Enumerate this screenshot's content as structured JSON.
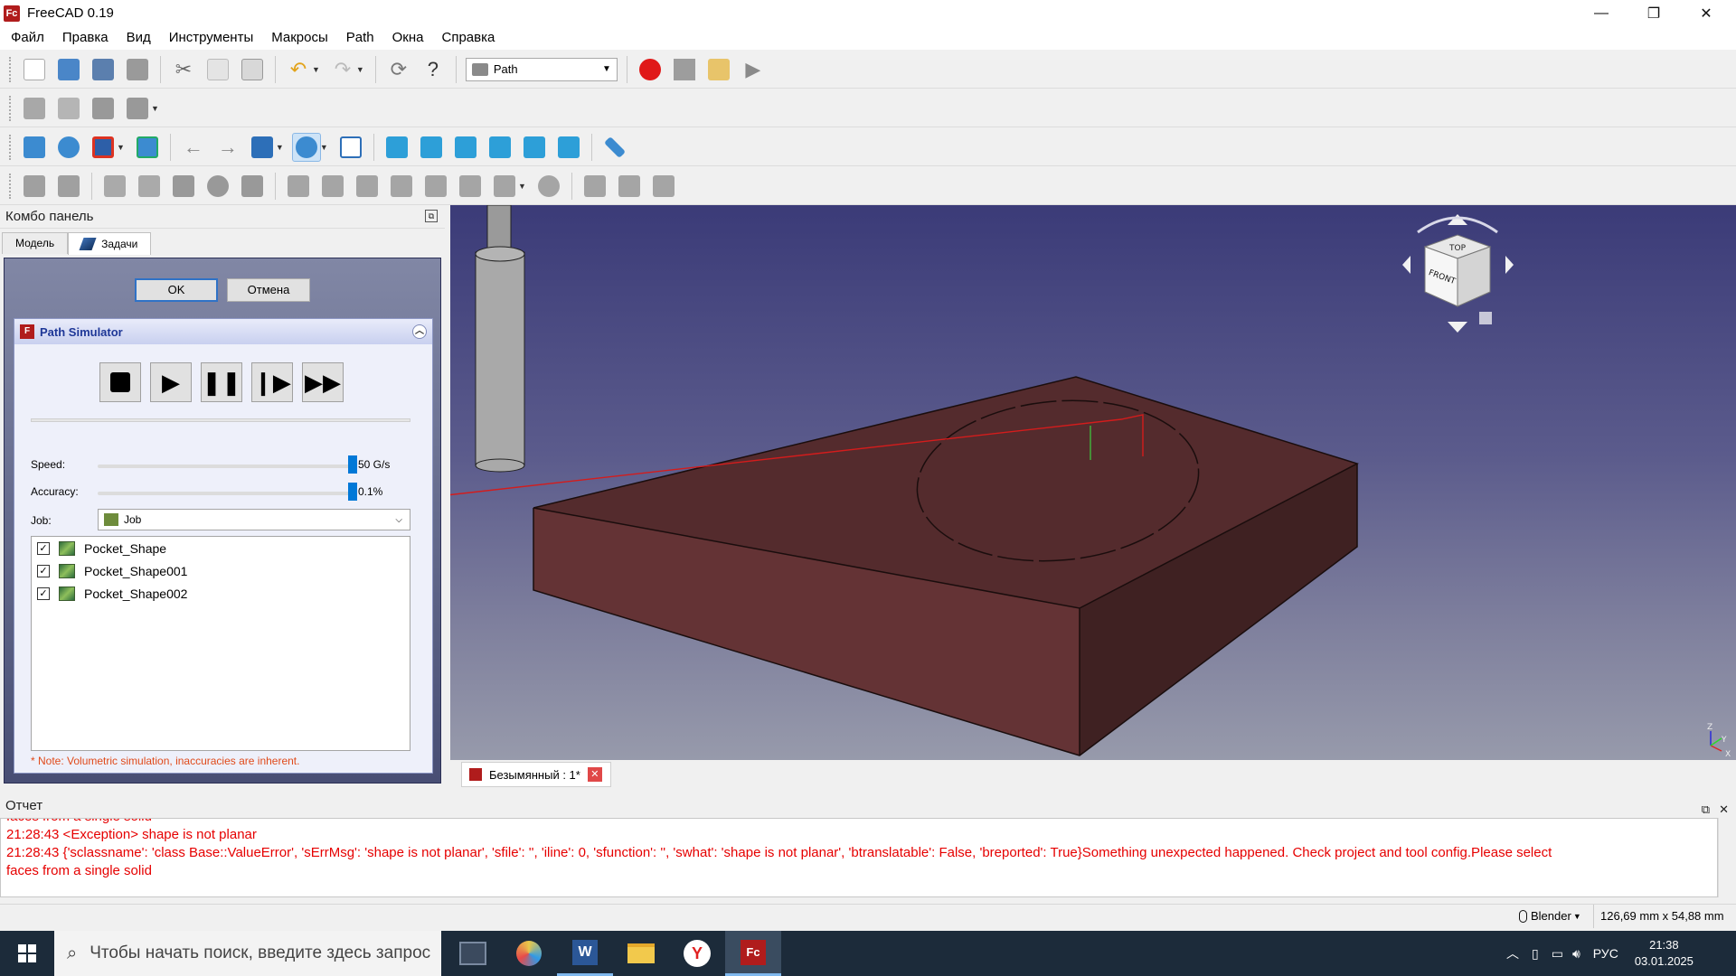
{
  "window": {
    "title": "FreeCAD 0.19",
    "icon_text": "Fc",
    "minimize": "—",
    "maximize": "❐",
    "close": "✕"
  },
  "menu": [
    "Файл",
    "Правка",
    "Вид",
    "Инструменты",
    "Макросы",
    "Path",
    "Окна",
    "Справка"
  ],
  "toolbar": {
    "workbench": "Path"
  },
  "combo": {
    "title": "Комбо панель",
    "tabs": {
      "model": "Модель",
      "tasks": "Задачи"
    },
    "ok": "OK",
    "cancel": "Отмена",
    "simulator": {
      "title": "Path Simulator",
      "speed_label": "Speed:",
      "speed_value": "50 G/s",
      "speed_level": 1.0,
      "accuracy_label": "Accuracy:",
      "accuracy_value": "0.1%",
      "accuracy_level": 1.0,
      "job_label": "Job:",
      "job_value": "Job",
      "operations": [
        {
          "name": "Pocket_Shape",
          "checked": true
        },
        {
          "name": "Pocket_Shape001",
          "checked": true
        },
        {
          "name": "Pocket_Shape002",
          "checked": true
        }
      ],
      "note": "* Note: Volumetric simulation, inaccuracies are inherent."
    }
  },
  "viewport": {
    "navcube": {
      "top_face": "TOP",
      "front_face": "FRONT"
    },
    "axis": {
      "x": "X",
      "y": "Y",
      "z": "Z"
    }
  },
  "document_tab": {
    "label": "Безымянный : 1*"
  },
  "report": {
    "title": "Отчет",
    "lines": [
      "faces from a single solid",
      "21:28:43  <Exception> shape is not planar",
      "21:28:43  {'sclassname': 'class Base::ValueError', 'sErrMsg': 'shape is not planar', 'sfile': '', 'iline': 0, 'sfunction': '', 'swhat': 'shape is not planar', 'btranslatable': False, 'breported': True}Something unexpected happened. Check project and tool config.Please select",
      "faces from a single solid"
    ]
  },
  "status": {
    "nav_style": "Blender",
    "dimensions": "126,69 mm x 54,88 mm"
  },
  "taskbar": {
    "search_placeholder": "Чтобы начать поиск, введите здесь запрос",
    "lang": "РУС",
    "time": "21:38",
    "date": "03.01.2025"
  },
  "colors": {
    "accent": "#0078d7",
    "error_text": "#e60000",
    "stock": "#5e2f31",
    "task_bg": "#484e74"
  }
}
